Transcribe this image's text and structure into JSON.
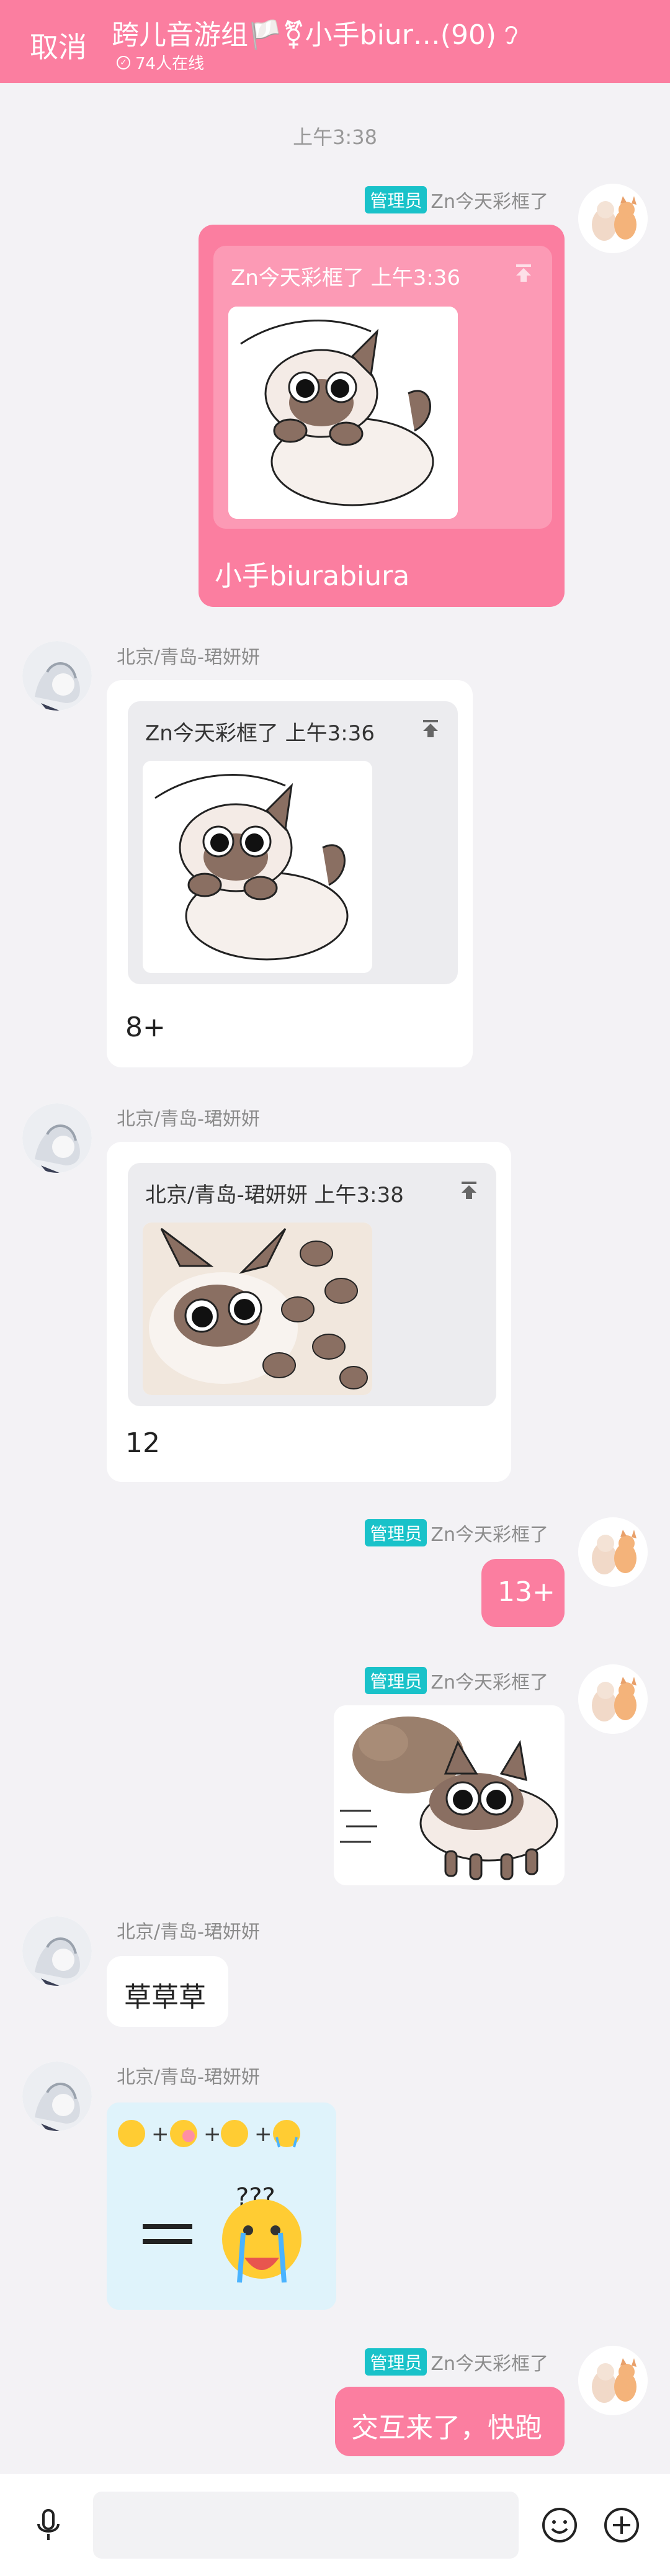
{
  "header": {
    "cancel_label": "取消",
    "title": "跨儿音游组🏳️⚧小手biur…(90)",
    "online": "74人在线"
  },
  "time_divider": "上午3:38",
  "messages": [
    {
      "sender": "Zn今天彩框了",
      "badge": "管理员",
      "quote_header": "Zn今天彩框了 上午3:36",
      "text": "小手biurabiura"
    },
    {
      "sender": "北京/青岛-珺妍妍",
      "quote_header": "Zn今天彩框了 上午3:36",
      "text": "8+"
    },
    {
      "sender": "北京/青岛-珺妍妍",
      "quote_header": "北京/青岛-珺妍妍 上午3:38",
      "text": "12"
    },
    {
      "sender": "Zn今天彩框了",
      "badge": "管理员",
      "text": "13+"
    },
    {
      "sender": "Zn今天彩框了",
      "badge": "管理员"
    },
    {
      "sender": "北京/青岛-珺妍妍",
      "text": "草草草"
    },
    {
      "sender": "北京/青岛-珺妍妍"
    },
    {
      "sender": "Zn今天彩框了",
      "badge": "管理员",
      "text": "交互来了，快跑"
    }
  ],
  "icons": {
    "mic": "microphone-icon",
    "emoji": "smile-icon",
    "plus": "plus-icon",
    "pin": "pin-top-icon"
  },
  "colors": {
    "brand": "#fb7ea0",
    "admin_badge": "#19c2c9",
    "background": "#f3f2f5"
  }
}
